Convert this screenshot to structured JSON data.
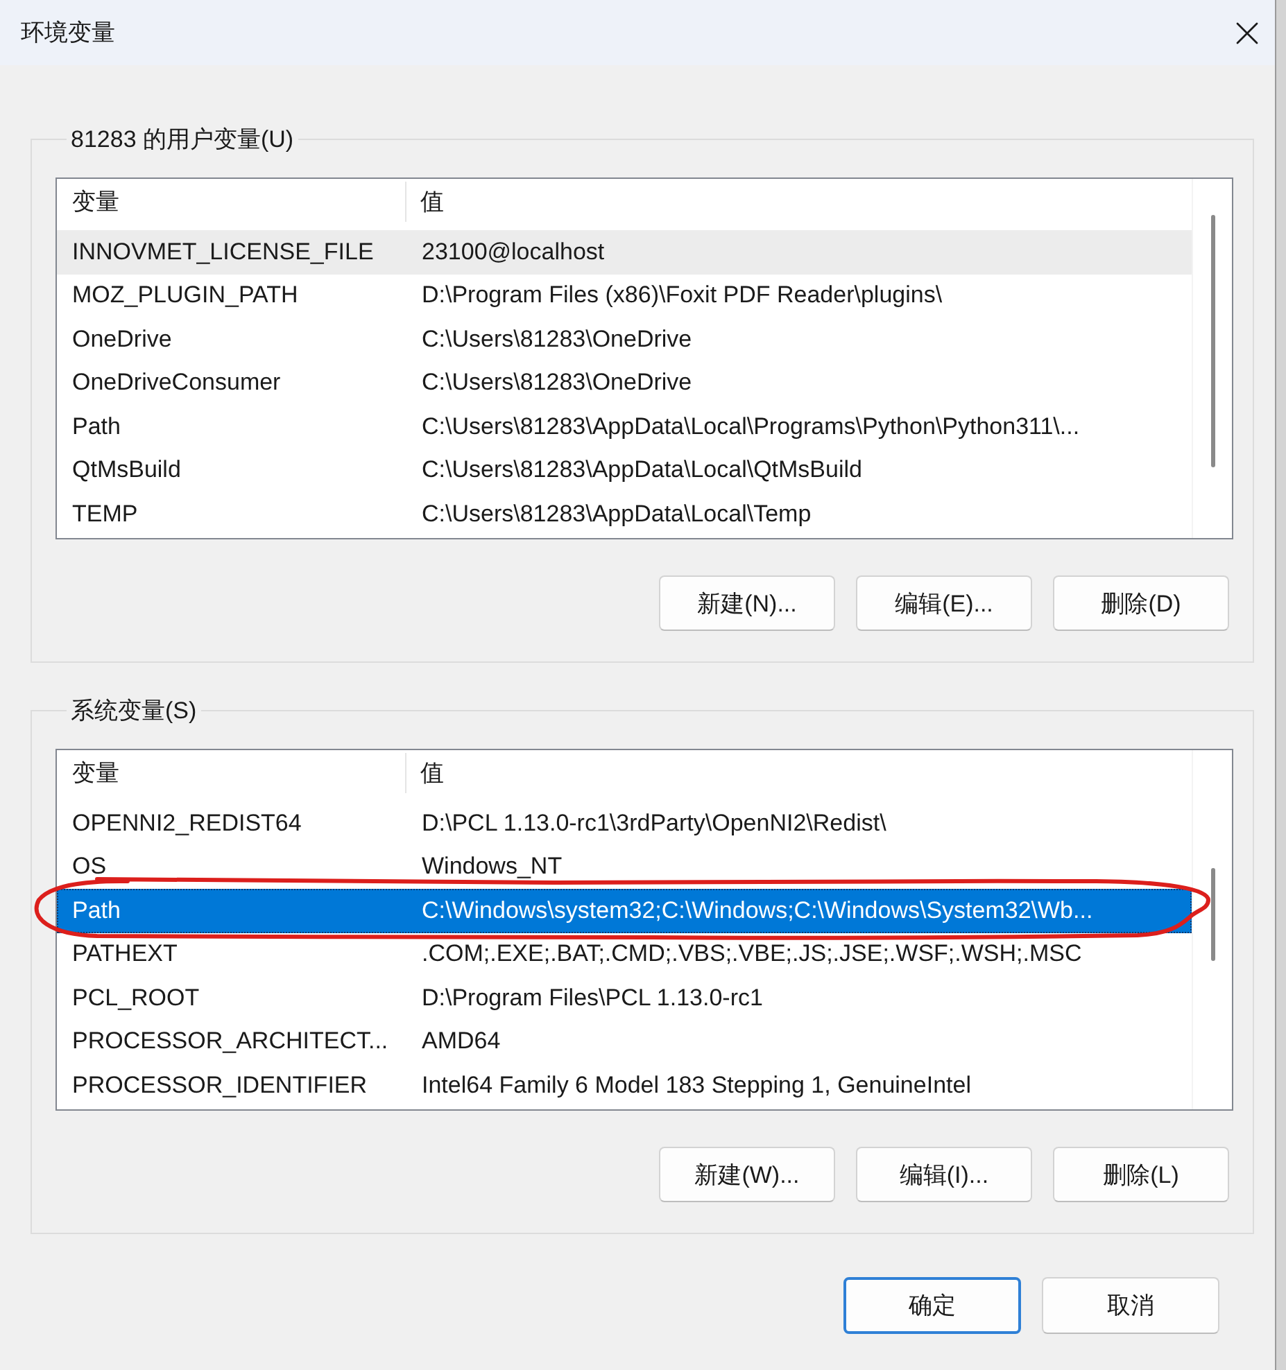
{
  "window": {
    "title": "环境变量"
  },
  "user_variables": {
    "title": "81283 的用户变量(U)",
    "focused": false,
    "columns": [
      "变量",
      "值"
    ],
    "rows": [
      {
        "name": "INNOVMET_LICENSE_FILE",
        "value": "23100@localhost",
        "selected": true
      },
      {
        "name": "MOZ_PLUGIN_PATH",
        "value": "D:\\Program Files (x86)\\Foxit PDF Reader\\plugins\\",
        "selected": false
      },
      {
        "name": "OneDrive",
        "value": "C:\\Users\\81283\\OneDrive",
        "selected": false
      },
      {
        "name": "OneDriveConsumer",
        "value": "C:\\Users\\81283\\OneDrive",
        "selected": false
      },
      {
        "name": "Path",
        "value": "C:\\Users\\81283\\AppData\\Local\\Programs\\Python\\Python311\\...",
        "selected": false
      },
      {
        "name": "QtMsBuild",
        "value": "C:\\Users\\81283\\AppData\\Local\\QtMsBuild",
        "selected": false
      },
      {
        "name": "TEMP",
        "value": "C:\\Users\\81283\\AppData\\Local\\Temp",
        "selected": false
      }
    ],
    "buttons": [
      "新建(N)...",
      "编辑(E)...",
      "删除(D)"
    ]
  },
  "system_variables": {
    "title": "系统变量(S)",
    "focused": true,
    "columns": [
      "变量",
      "值"
    ],
    "rows": [
      {
        "name": "OPENNI2_REDIST64",
        "value": "D:\\PCL 1.13.0-rc1\\3rdParty\\OpenNI2\\Redist\\",
        "selected": false,
        "circled": false
      },
      {
        "name": "OS",
        "value": "Windows_NT",
        "selected": false,
        "circled": false
      },
      {
        "name": "Path",
        "value": "C:\\Windows\\system32;C:\\Windows;C:\\Windows\\System32\\Wb...",
        "selected": true,
        "circled": true
      },
      {
        "name": "PATHEXT",
        "value": ".COM;.EXE;.BAT;.CMD;.VBS;.VBE;.JS;.JSE;.WSF;.WSH;.MSC",
        "selected": false,
        "circled": false
      },
      {
        "name": "PCL_ROOT",
        "value": "D:\\Program Files\\PCL 1.13.0-rc1",
        "selected": false,
        "circled": false
      },
      {
        "name": "PROCESSOR_ARCHITECT...",
        "value": "AMD64",
        "selected": false,
        "circled": false
      },
      {
        "name": "PROCESSOR_IDENTIFIER",
        "value": "Intel64 Family 6 Model 183 Stepping 1, GenuineIntel",
        "selected": false,
        "circled": false
      }
    ],
    "buttons": [
      "新建(W)...",
      "编辑(I)...",
      "删除(L)"
    ]
  },
  "dialog_buttons": [
    {
      "label": "确定",
      "default": true
    },
    {
      "label": "取消",
      "default": false
    }
  ]
}
